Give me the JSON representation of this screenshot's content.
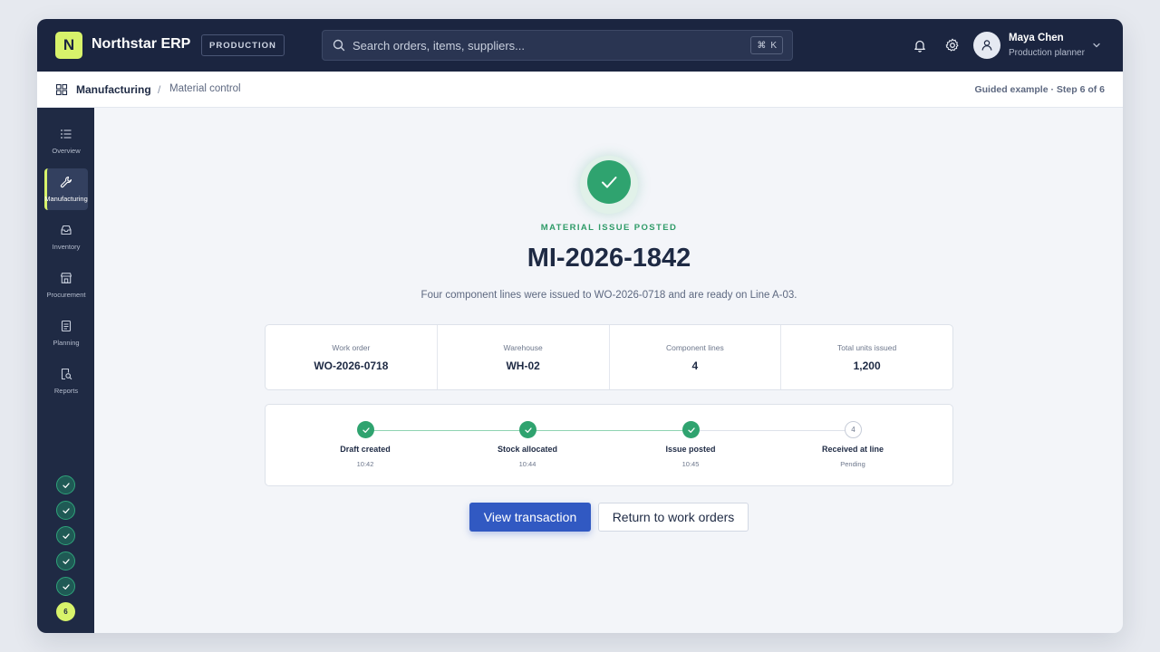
{
  "app": {
    "title": "Northstar ERP",
    "logo_letter": "N",
    "environment": "PRODUCTION"
  },
  "search": {
    "placeholder": "Search orders, items, suppliers...",
    "shortcut_symbol": "⌘",
    "shortcut_key": "K"
  },
  "user": {
    "name": "Maya Chen",
    "role": "Production planner"
  },
  "breadcrumb": {
    "section": "Manufacturing",
    "separator": "/",
    "page": "Material control"
  },
  "guide": {
    "progress_text": "Guided example · Step 6 of 6"
  },
  "sidebar": {
    "items": [
      {
        "label": "Overview",
        "icon": "list-icon"
      },
      {
        "label": "Manufacturing",
        "icon": "wrench-icon",
        "active": true
      },
      {
        "label": "Inventory",
        "icon": "inbox-icon"
      },
      {
        "label": "Procurement",
        "icon": "store-icon"
      },
      {
        "label": "Planning",
        "icon": "document-icon"
      },
      {
        "label": "Reports",
        "icon": "report-search-icon"
      }
    ],
    "steps": {
      "completed": 5,
      "current_label": "6"
    }
  },
  "result": {
    "status": "MATERIAL ISSUE POSTED",
    "document_number": "MI-2026-1842",
    "description": "Four component lines were issued to WO-2026-0718 and are ready on Line A-03."
  },
  "stats": [
    {
      "label": "Work order",
      "value": "WO-2026-0718"
    },
    {
      "label": "Warehouse",
      "value": "WH-02"
    },
    {
      "label": "Component lines",
      "value": "4"
    },
    {
      "label": "Total units issued",
      "value": "1,200"
    }
  ],
  "timeline": [
    {
      "title": "Draft created",
      "time": "10:42",
      "done": true
    },
    {
      "title": "Stock allocated",
      "time": "10:44",
      "done": true
    },
    {
      "title": "Issue posted",
      "time": "10:45",
      "done": true
    },
    {
      "title": "Received at line",
      "time": "Pending",
      "done": false,
      "number": "4"
    }
  ],
  "actions": {
    "primary": "View transaction",
    "secondary": "Return to work orders"
  },
  "colors": {
    "brand_accent": "#d8f36b",
    "navy": "#1b2540",
    "success": "#2fa36f",
    "primary_button": "#3159c2"
  }
}
